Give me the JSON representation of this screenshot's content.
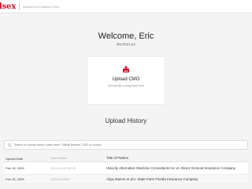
{
  "header": {
    "logo": "lsex",
    "subtitle": "AnchorLex Extractor 2024"
  },
  "welcome": {
    "title": "Welcome, Eric",
    "company": "AnchorLex"
  },
  "upload": {
    "title": "Upload CMO",
    "hint": "Choose file or drag them here",
    "icon": "upload-icon",
    "accent": "#c8102e"
  },
  "history": {
    "title": "Upload History",
    "search_placeholder": "Search for upload history (case name, Official Number, CMO or county)",
    "columns": [
      "Upload Date",
      "Case Number",
      "Title of Parties"
    ],
    "rows": [
      {
        "date": "Feb 15, 2025",
        "case": "2024-CA-000-NC-25",
        "parties": "Velocity Alternative Medicine Consultants Inc vs. Direct General Insurance Company"
      },
      {
        "date": "Feb 15, 2025",
        "case": "CACE23005967",
        "parties": "Aliya Zaeem et al v. State Farm Florida Insurance Company"
      }
    ]
  }
}
